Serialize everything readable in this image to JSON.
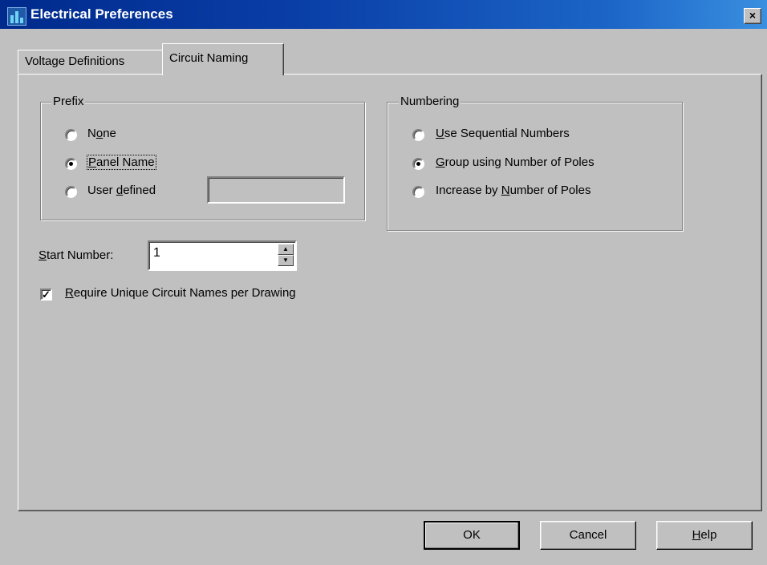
{
  "window": {
    "title": "Electrical Preferences",
    "close_glyph": "×"
  },
  "tabs": [
    {
      "label": "Voltage Definitions",
      "active": false
    },
    {
      "label": "Circuit Naming",
      "active": true
    }
  ],
  "prefix": {
    "legend": "Prefix",
    "options": [
      {
        "pre": "N",
        "ul": "o",
        "post": "ne",
        "checked": false
      },
      {
        "pre": "",
        "ul": "P",
        "post": "anel Name",
        "checked": true
      },
      {
        "pre": "User ",
        "ul": "d",
        "post": "efined",
        "checked": false
      }
    ],
    "user_defined_value": ""
  },
  "numbering": {
    "legend": "Numbering",
    "options": [
      {
        "pre": "",
        "ul": "U",
        "post": "se Sequential Numbers",
        "checked": false
      },
      {
        "pre": "",
        "ul": "G",
        "post": "roup using Number of Poles",
        "checked": true
      },
      {
        "pre": "Increase by ",
        "ul": "N",
        "post": "umber of Poles",
        "checked": false
      }
    ]
  },
  "start_number": {
    "pre": "",
    "ul": "S",
    "post": "tart Number:",
    "value": "1"
  },
  "unique_names": {
    "pre": "",
    "ul": "R",
    "post": "equire Unique Circuit Names per Drawing",
    "checked": true
  },
  "buttons": {
    "ok": "OK",
    "cancel": "Cancel",
    "help": {
      "pre": "",
      "ul": "H",
      "post": "elp"
    }
  },
  "colors": {
    "titlebar_start": "#002a8c",
    "titlebar_end": "#3a8fe0",
    "face": "#c0c0c0"
  },
  "icons": {
    "app": "electrical-app-icon",
    "close": "close-icon",
    "spin_up": "spin-up-icon",
    "spin_down": "spin-down-icon"
  }
}
